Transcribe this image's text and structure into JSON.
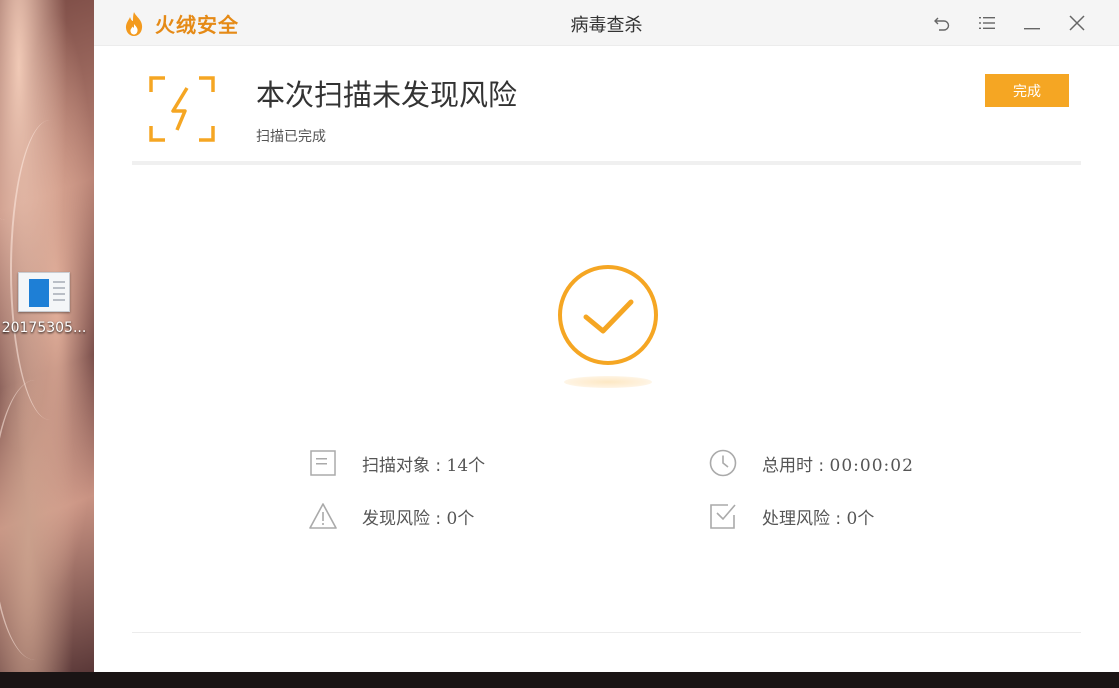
{
  "desktop": {
    "icon_label": "20175305..."
  },
  "app": {
    "brand_name": "火绒安全",
    "window_title": "病毒查杀",
    "brand_color": "#e58a16",
    "accent_color": "#f5a623",
    "controls": [
      {
        "name": "back-icon"
      },
      {
        "name": "menu-icon"
      },
      {
        "name": "minimize-icon"
      },
      {
        "name": "close-icon"
      }
    ]
  },
  "result": {
    "title": "本次扫描未发现风险",
    "subtitle": "扫描已完成",
    "done_label": "完成"
  },
  "stats": {
    "scan_targets": {
      "label": "扫描对象 : ",
      "value": "14个"
    },
    "elapsed": {
      "label": "总用时 : ",
      "value": "00:00:02"
    },
    "risks_found": {
      "label": "发现风险 : ",
      "value": "0个"
    },
    "risks_handled": {
      "label": "处理风险 : ",
      "value": "0个"
    }
  }
}
